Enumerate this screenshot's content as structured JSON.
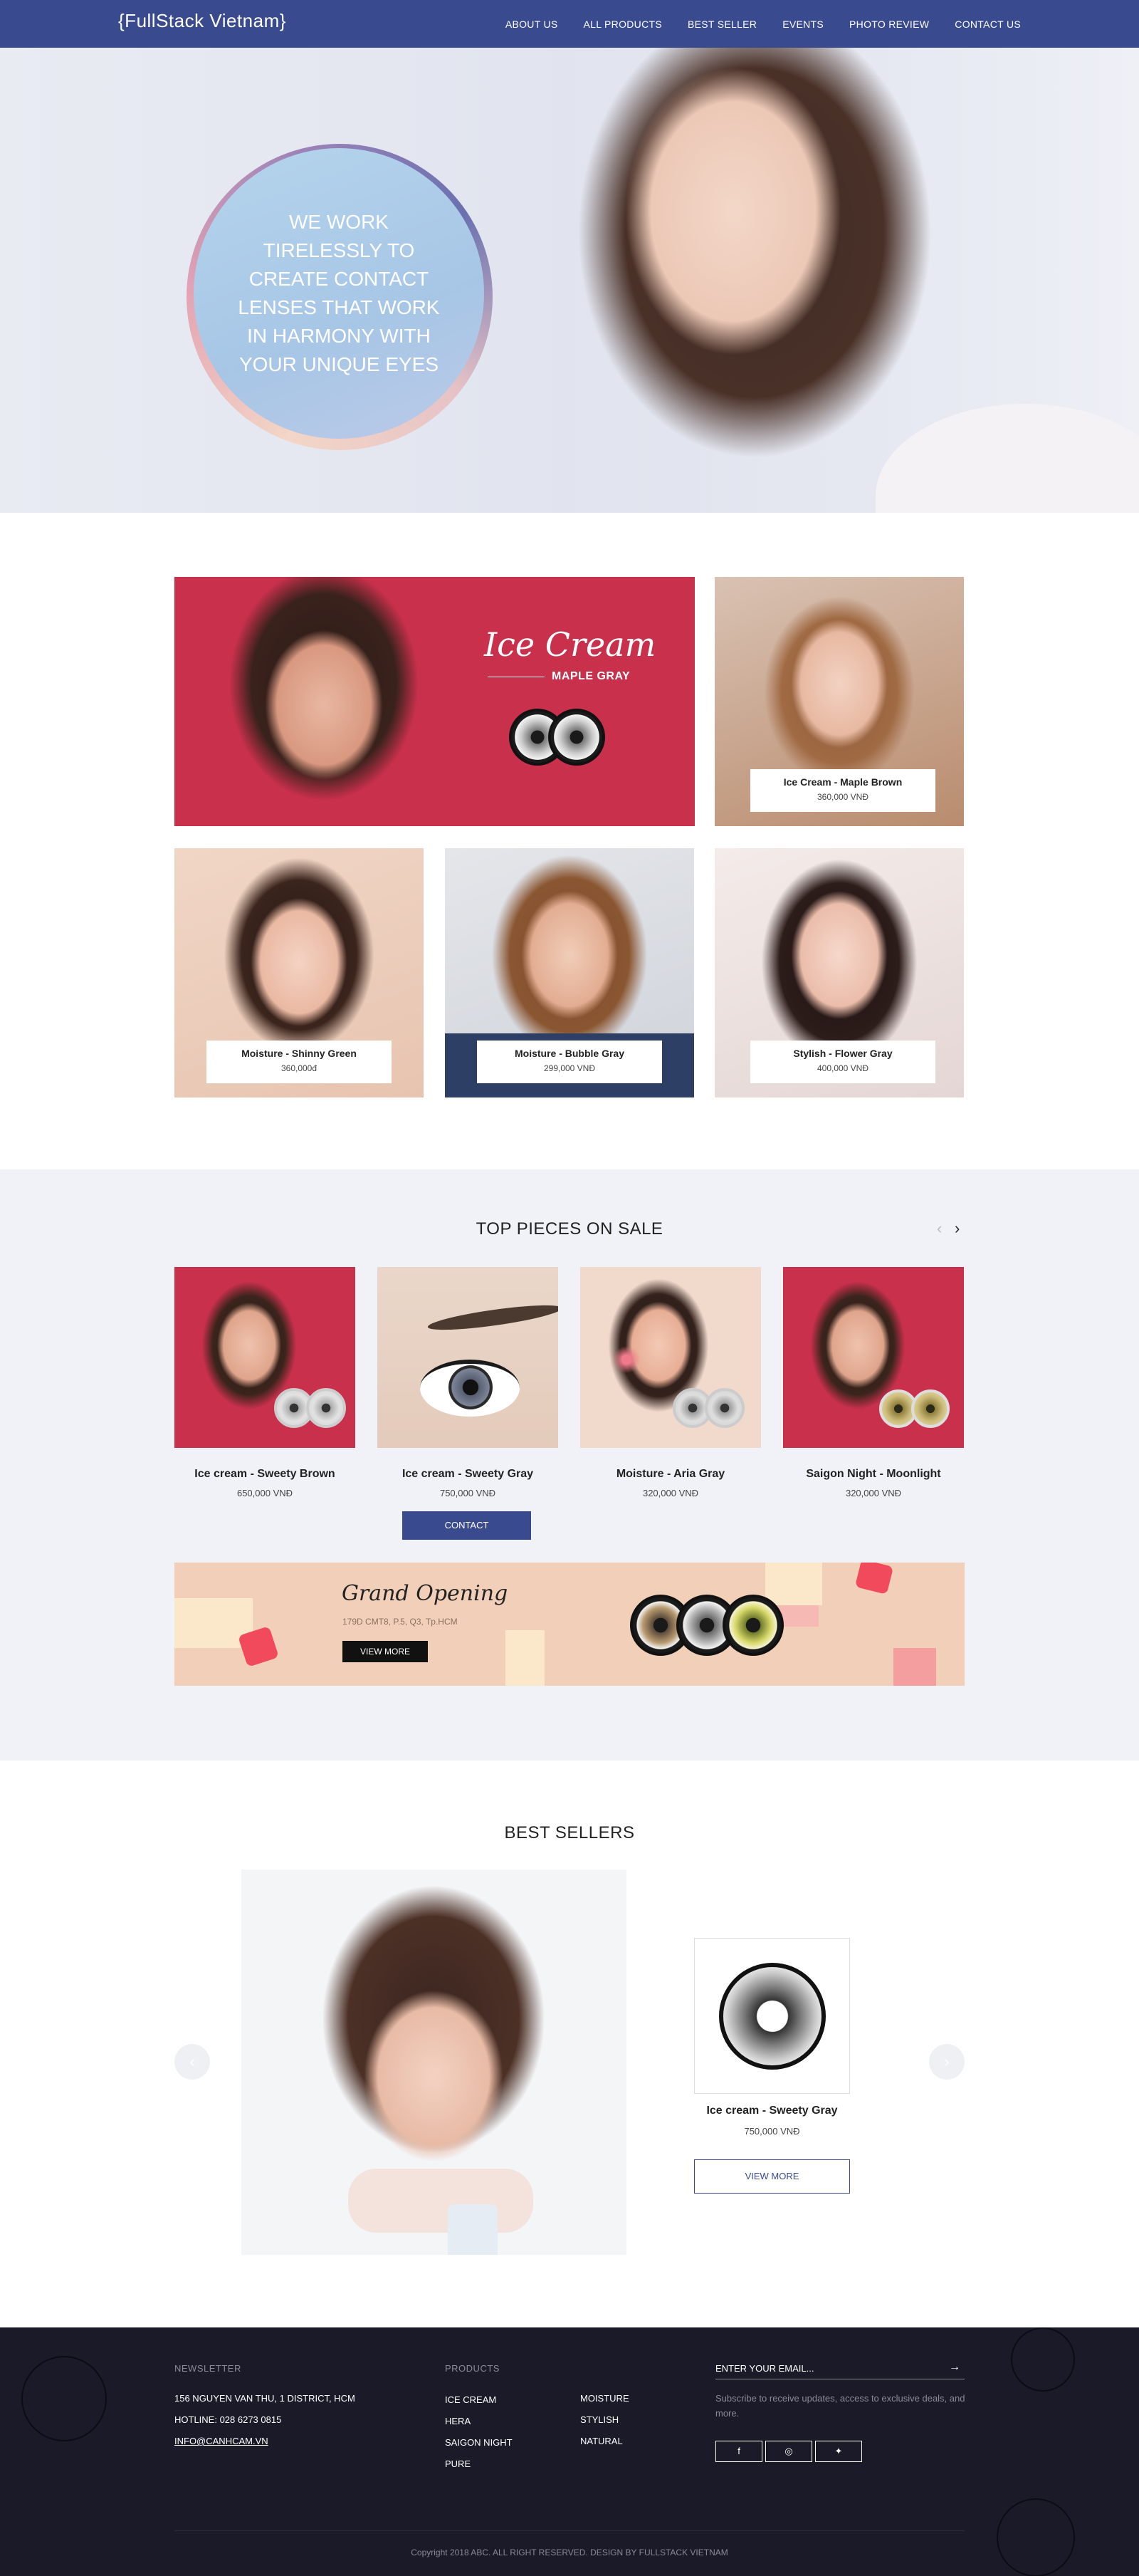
{
  "header": {
    "logo": "{FullStack Vietnam}",
    "nav": [
      "ABOUT US",
      "ALL PRODUCTS",
      "BEST SELLER",
      "EVENTS",
      "PHOTO REVIEW",
      "CONTACT US"
    ]
  },
  "hero": {
    "tagline": "WE WORK TIRELESSLY TO CREATE CONTACT LENSES THAT WORK IN HARMONY WITH YOUR UNIQUE EYES"
  },
  "featured": {
    "banner_title": "Ice Cream",
    "banner_subtitle": "MAPLE GRAY",
    "tiles": [
      {
        "name": "Ice Cream - Maple Brown",
        "price": "360,000 VNĐ"
      },
      {
        "name": "Moisture - Shinny Green",
        "price": "360,000đ"
      },
      {
        "name": "Moisture - Bubble Gray",
        "price": "299,000 VNĐ"
      },
      {
        "name": "Stylish - Flower Gray",
        "price": "400,000 VNĐ"
      }
    ]
  },
  "top_pieces": {
    "title": "TOP PIECES ON SALE",
    "products": [
      {
        "name": "Ice cream - Sweety Brown",
        "price": "650,000 VNĐ"
      },
      {
        "name": "Ice cream - Sweety Gray",
        "price": "750,000 VNĐ"
      },
      {
        "name": "Moisture - Aria Gray",
        "price": "320,000 VNĐ"
      },
      {
        "name": "Saigon Night - Moonlight",
        "price": "320,000 VNĐ"
      }
    ],
    "contact_label": "CONTACT"
  },
  "promo": {
    "title": "Grand Opening",
    "address": "179D CMT8, P.5, Q3, Tp.HCM",
    "button": "VIEW MORE"
  },
  "best_sellers": {
    "title": "BEST SELLERS",
    "product_name": "Ice cream - Sweety Gray",
    "product_price": "750,000 VNĐ",
    "button": "VIEW MORE"
  },
  "footer": {
    "newsletter_heading": "NEWSLETTER",
    "address": "156 NGUYEN VAN THU, 1 DISTRICT, HCM",
    "hotline": "HOTLINE: 028 6273 0815",
    "email": "INFO@CANHCAM.VN",
    "products_heading": "PRODUCTS",
    "products_col1": [
      "ICE CREAM",
      "HERA",
      "SAIGON NIGHT",
      "PURE"
    ],
    "products_col2": [
      "MOISTURE",
      "STYLISH",
      "NATURAL"
    ],
    "email_placeholder": "ENTER YOUR EMAIL...",
    "subscribe_desc": "Subscribe to receive updates, access to exclusive deals, and more.",
    "copyright": "Copyright 2018 ABC. ALL RIGHT RESERVED. DESIGN BY FULLSTACK VIETNAM"
  },
  "colors": {
    "brand": "#3a4a8e",
    "footer_bg": "#1a1a28",
    "section_gray": "#f1f2f7"
  }
}
